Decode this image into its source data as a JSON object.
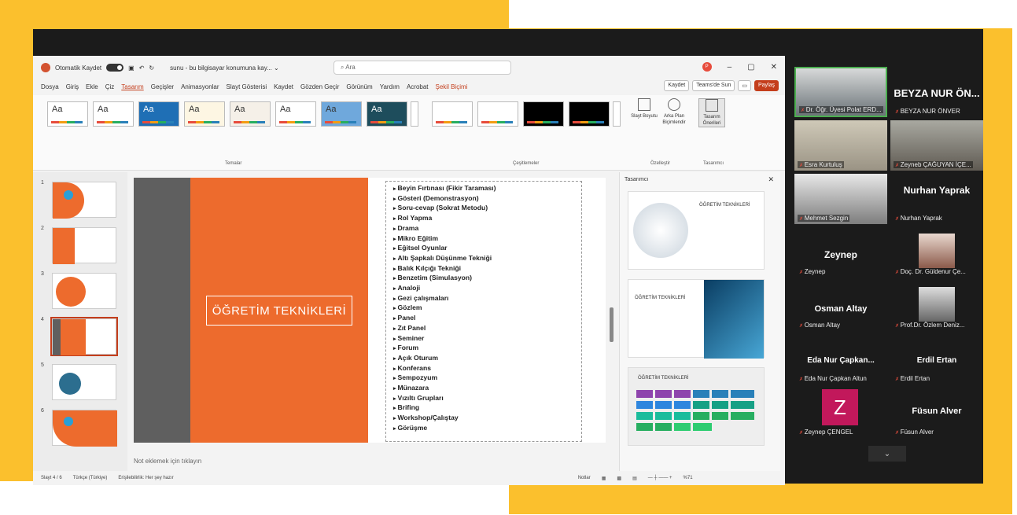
{
  "titlebar": {
    "autosave": "Otomatik Kaydet",
    "filename": "sunu - bu bilgisayar konumuna kay... ⌄",
    "search_placeholder": "Ara",
    "avatar_initial": "P"
  },
  "menu": [
    "Dosya",
    "Giriş",
    "Ekle",
    "Çiz",
    "Tasarım",
    "Geçişler",
    "Animasyonlar",
    "Slayt Gösterisi",
    "Kaydet",
    "Gözden Geçir",
    "Görünüm",
    "Yardım",
    "Acrobat",
    "Şekil Biçimi"
  ],
  "menu_right": {
    "record": "Kaydet",
    "teams": "Teams'de Sun",
    "share": "Paylaş"
  },
  "ribbon": {
    "themes_label": "Temalar",
    "variants_label": "Çeşitlemeler",
    "customize_label": "Özelleştir",
    "designer_label": "Tasarımcı",
    "slide_size": "Slayt Boyutu",
    "bg_format": "Arka Plan Biçimlendir",
    "design_ideas": "Tasarım Önerileri",
    "theme_text": "Aa"
  },
  "slide_numbers": [
    "1",
    "2",
    "3",
    "4",
    "5",
    "6"
  ],
  "slide": {
    "title": "ÖĞRETİM TEKNİKLERİ",
    "bullets": [
      "Beyin Fırtınası (Fikir Taraması)",
      "Gösteri (Demonstrasyon)",
      "Soru-cevap (Sokrat Metodu)",
      "Rol Yapma",
      "Drama",
      "Mikro Eğitim",
      "Eğitsel Oyunlar",
      "Altı Şapkalı Düşünme Tekniği",
      "Balık Kılçığı Tekniği",
      "Benzetim (Simulasyon)",
      "Analoji",
      "Gezi çalışmaları",
      "Gözlem",
      "Panel",
      "Zıt Panel",
      "Seminer",
      "Forum",
      "Açık Oturum",
      "Konferans",
      "Sempozyum",
      "Münazara",
      "Vızıltı Grupları",
      "Brifing",
      "Workshop/Çalıştay",
      "Görüşme"
    ]
  },
  "notes": "Not eklemek için tıklayın",
  "status": {
    "slide": "Slayt 4 / 6",
    "lang": "Türkçe (Türkiye)",
    "access": "Erişilebilirlik: Her şey hazır",
    "notes_btn": "Notlar",
    "zoom": "%71"
  },
  "designer": {
    "title": "Tasarımcı",
    "card_title": "ÖĞRETİM TEKNİKLERİ"
  },
  "participants": [
    {
      "label": "Dr. Öğr. Üyesi Polat ERD...",
      "type": "video",
      "active": true
    },
    {
      "label": "BEYZA NUR ÖNVER",
      "big": "BEYZA NUR ÖN...",
      "type": "name"
    },
    {
      "label": "Esra Kurtuluş",
      "type": "video"
    },
    {
      "label": "Zeyneb ÇAĞUYAN İÇE...",
      "type": "video"
    },
    {
      "label": "Mehmet Sezgin",
      "type": "video"
    },
    {
      "label": "Nurhan Yaprak",
      "big": "Nurhan Yaprak",
      "type": "name"
    },
    {
      "label": "Zeynep",
      "big": "Zeynep",
      "type": "name"
    },
    {
      "label": "Doç. Dr. Güldenur Çe...",
      "type": "video"
    },
    {
      "label": "Osman Altay",
      "big": "Osman Altay",
      "type": "name"
    },
    {
      "label": "Prof.Dr. Özlem Deniz...",
      "type": "video"
    },
    {
      "label": "Eda Nur Çapkan Altun",
      "big": "Eda Nur Çapkan...",
      "type": "name"
    },
    {
      "label": "Erdil Ertan",
      "big": "Erdil Ertan",
      "type": "name"
    },
    {
      "label": "Zeynep ÇENGEL",
      "big": "Z",
      "type": "initial"
    },
    {
      "label": "Füsun Alver",
      "big": "Füsun Alver",
      "type": "name"
    }
  ],
  "colors": {
    "accent": "#c43e1c",
    "slide_orange": "#ed6b2d",
    "frame_yellow": "#fbc02d"
  }
}
